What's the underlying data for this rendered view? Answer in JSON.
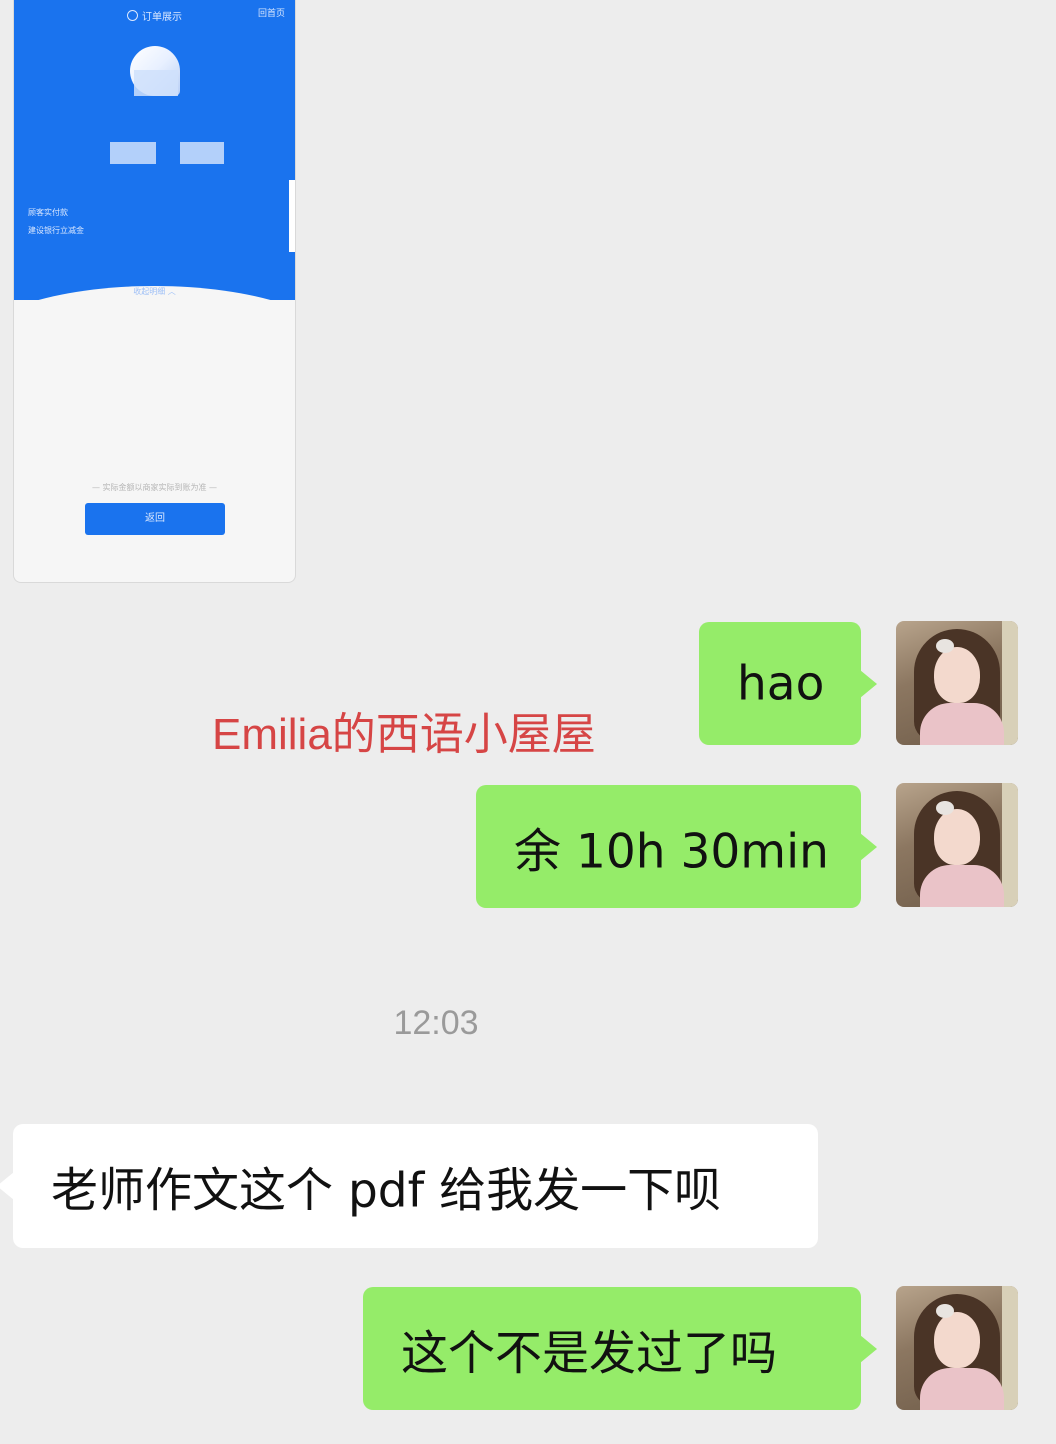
{
  "shared_screenshot": {
    "title": "订单展示",
    "home_link": "回首页",
    "detail_lines": [
      "顾客实付款",
      "建设银行立减金"
    ],
    "collapse_label": "收起明细 ︿",
    "note": "— 实际金额以商家实际到账为准 —",
    "button_label": "返回"
  },
  "watermark": "Emilia的西语小屋屋",
  "timestamp": "12:03",
  "messages": [
    {
      "side": "right",
      "text": "hao"
    },
    {
      "side": "right",
      "text": "余 10h 30min"
    },
    {
      "side": "left",
      "text": "老师作文这个 pdf 给我发一下呗"
    },
    {
      "side": "right",
      "text": "这个不是发过了吗"
    }
  ],
  "colors": {
    "chat_background": "#ededed",
    "sent_bubble": "#95ec69",
    "received_bubble": "#ffffff",
    "screenshot_blue": "#1a73ee",
    "watermark": "#d64545"
  }
}
